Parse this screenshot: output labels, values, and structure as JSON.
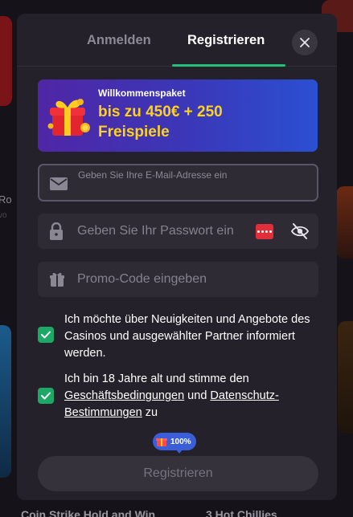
{
  "tabs": {
    "login": "Anmelden",
    "register": "Registrieren"
  },
  "promo": {
    "kicker": "Willkommenspaket",
    "line1": "bis zu 450€ + 250",
    "line2": "Freispiele"
  },
  "fields": {
    "email_placeholder": "Geben Sie Ihre E-Mail-Adresse ein",
    "password_placeholder": "Geben Sie Ihr Passwort ein",
    "promo_placeholder": "Promo-Code eingeben"
  },
  "consents": {
    "newsletter": {
      "text": "Ich möchte über Neuigkeiten und Angebote des Casinos und ausgewählter Partner informiert werden.",
      "checked": true
    },
    "terms": {
      "prefix": "Ich bin 18 Jahre alt und stimme den ",
      "terms_link": "Geschäftsbedingungen",
      "middle": " und ",
      "privacy_link": "Datenschutz-Bestimmungen",
      "suffix": " zu",
      "checked": true
    }
  },
  "progress_badge": "100%",
  "submit_label": "Registrieren",
  "background": {
    "game_left": "Ro",
    "game_left_sub": "vo",
    "bottom_game_1": "Coin Strike Hold and Win",
    "bottom_game_2": "3 Hot Chillies"
  },
  "colors": {
    "accent": "#24c07a",
    "checkbox": "#1ea866",
    "promo_highlight": "#ffd21a",
    "badge": "#3a5ed8"
  },
  "icons": {
    "close": "close-icon",
    "promo": "gift-box-icon",
    "email": "envelope-icon",
    "password": "lock-icon",
    "visibility": "eye-off-icon",
    "promo_code": "gift-icon",
    "checkbox": "check-icon"
  }
}
